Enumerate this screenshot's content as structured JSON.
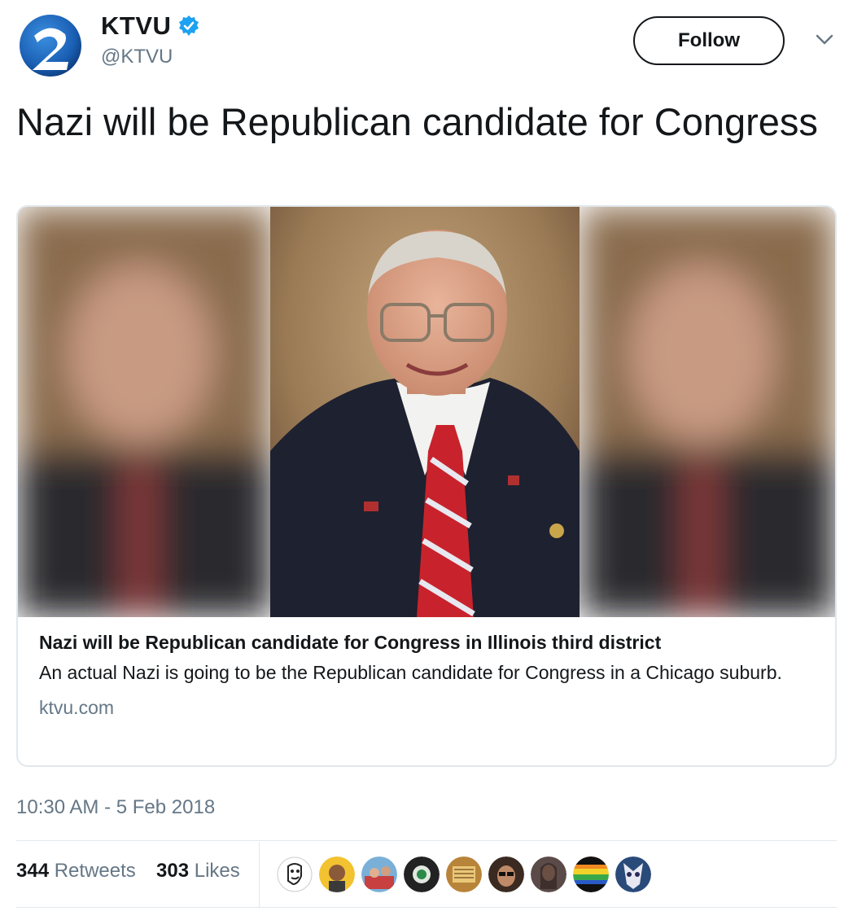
{
  "account": {
    "display_name": "KTVU",
    "handle": "@KTVU",
    "verified_icon": "verified-badge-icon",
    "brand_color": "#1a5fb4"
  },
  "follow_button": {
    "label": "Follow"
  },
  "menu_icon": "chevron-down-icon",
  "tweet": {
    "text": "Nazi will be Republican candidate for Congress"
  },
  "card": {
    "title": "Nazi will be Republican candidate for Congress in Illinois third district",
    "description": "An actual Nazi is going to be the Republican candidate for Congress in a Chicago suburb.",
    "domain": "ktvu.com",
    "image_icon": "portrait-photo"
  },
  "timestamp": "10:30 AM - 5 Feb 2018",
  "stats": {
    "retweets_count": "344",
    "retweets_label": "Retweets",
    "likes_count": "303",
    "likes_label": "Likes"
  },
  "likers": [
    "liker-avatar-1",
    "liker-avatar-2",
    "liker-avatar-3",
    "liker-avatar-4",
    "liker-avatar-5",
    "liker-avatar-6",
    "liker-avatar-7",
    "liker-avatar-8",
    "liker-avatar-9"
  ],
  "colors": {
    "text": "#14171a",
    "secondary": "#657786",
    "border": "#e1e8ed",
    "verified": "#1da1f2"
  }
}
